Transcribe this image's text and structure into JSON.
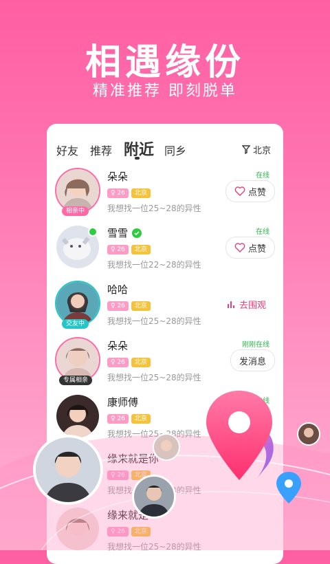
{
  "hero": {
    "title": "相遇缘份",
    "subtitle": "精准推荐 即刻脱单"
  },
  "tabs": [
    {
      "label": "好友"
    },
    {
      "label": "推荐"
    },
    {
      "label": "附近"
    },
    {
      "label": "同乡"
    }
  ],
  "filter": {
    "label": "北京",
    "icon": "filter-icon"
  },
  "rows": [
    {
      "name": "朵朵",
      "age": "26",
      "city": "北京",
      "desc": "我想找一位25~28的异性",
      "status": "在线",
      "action": "点赞",
      "badge": "相亲中",
      "verified": false
    },
    {
      "name": "雪雪",
      "age": "26",
      "city": "北京",
      "desc": "我想找一位22~28的异性",
      "status": "在线",
      "action": "点赞",
      "badge": "",
      "verified": true
    },
    {
      "name": "哈哈",
      "age": "26",
      "city": "北京",
      "desc": "我想找一位25~28的异性",
      "status": "",
      "action": "去围观",
      "badge": "交友中",
      "verified": false
    },
    {
      "name": "朵朵",
      "age": "26",
      "city": "北京",
      "desc": "我想找一位25~28的异性",
      "status": "刚刚在线",
      "action": "发消息",
      "badge": "专属相亲",
      "verified": false
    },
    {
      "name": "康师傅",
      "age": "26",
      "city": "北京",
      "desc": "我想找一位25~28的异性",
      "status": "在线",
      "action": "",
      "badge": "",
      "verified": false
    },
    {
      "name": "缘来就是你",
      "age": "26",
      "city": "北京",
      "desc": "我想找一位25~28的异性",
      "status": "",
      "action": "",
      "badge": "",
      "verified": false
    },
    {
      "name": "缘来就是",
      "age": "26",
      "city": "北京",
      "desc": "我想找一位25~28的异性",
      "status": "",
      "action": "",
      "badge": "",
      "verified": false
    }
  ],
  "colors": {
    "accent": "#ff5fa2",
    "online": "#2cb74a",
    "tag_age": "#ff9cc6",
    "tag_city": "#f5c33b"
  }
}
